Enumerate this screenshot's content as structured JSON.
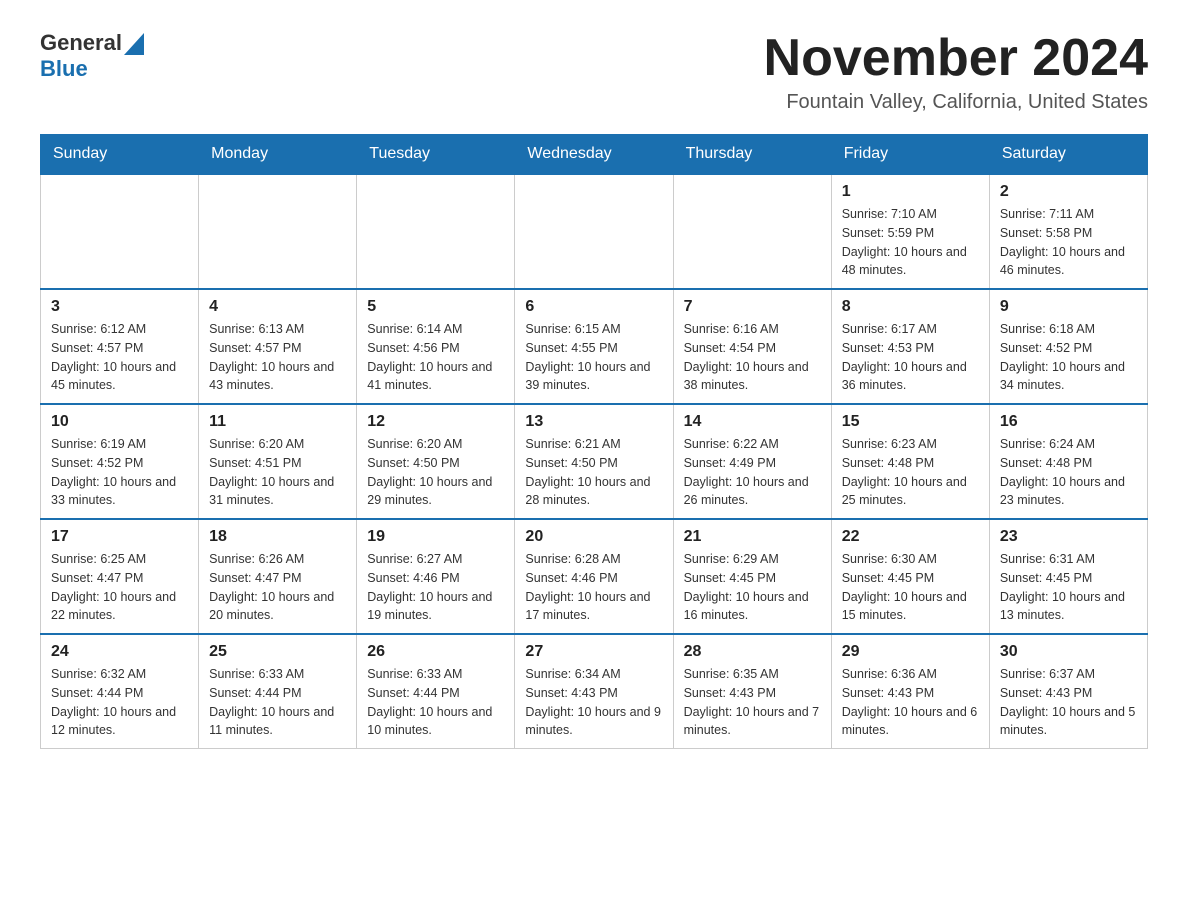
{
  "header": {
    "logo_general": "General",
    "logo_blue": "Blue",
    "month_title": "November 2024",
    "location": "Fountain Valley, California, United States"
  },
  "days_of_week": [
    "Sunday",
    "Monday",
    "Tuesday",
    "Wednesday",
    "Thursday",
    "Friday",
    "Saturday"
  ],
  "weeks": [
    [
      {
        "day": "",
        "info": ""
      },
      {
        "day": "",
        "info": ""
      },
      {
        "day": "",
        "info": ""
      },
      {
        "day": "",
        "info": ""
      },
      {
        "day": "",
        "info": ""
      },
      {
        "day": "1",
        "info": "Sunrise: 7:10 AM\nSunset: 5:59 PM\nDaylight: 10 hours and 48 minutes."
      },
      {
        "day": "2",
        "info": "Sunrise: 7:11 AM\nSunset: 5:58 PM\nDaylight: 10 hours and 46 minutes."
      }
    ],
    [
      {
        "day": "3",
        "info": "Sunrise: 6:12 AM\nSunset: 4:57 PM\nDaylight: 10 hours and 45 minutes."
      },
      {
        "day": "4",
        "info": "Sunrise: 6:13 AM\nSunset: 4:57 PM\nDaylight: 10 hours and 43 minutes."
      },
      {
        "day": "5",
        "info": "Sunrise: 6:14 AM\nSunset: 4:56 PM\nDaylight: 10 hours and 41 minutes."
      },
      {
        "day": "6",
        "info": "Sunrise: 6:15 AM\nSunset: 4:55 PM\nDaylight: 10 hours and 39 minutes."
      },
      {
        "day": "7",
        "info": "Sunrise: 6:16 AM\nSunset: 4:54 PM\nDaylight: 10 hours and 38 minutes."
      },
      {
        "day": "8",
        "info": "Sunrise: 6:17 AM\nSunset: 4:53 PM\nDaylight: 10 hours and 36 minutes."
      },
      {
        "day": "9",
        "info": "Sunrise: 6:18 AM\nSunset: 4:52 PM\nDaylight: 10 hours and 34 minutes."
      }
    ],
    [
      {
        "day": "10",
        "info": "Sunrise: 6:19 AM\nSunset: 4:52 PM\nDaylight: 10 hours and 33 minutes."
      },
      {
        "day": "11",
        "info": "Sunrise: 6:20 AM\nSunset: 4:51 PM\nDaylight: 10 hours and 31 minutes."
      },
      {
        "day": "12",
        "info": "Sunrise: 6:20 AM\nSunset: 4:50 PM\nDaylight: 10 hours and 29 minutes."
      },
      {
        "day": "13",
        "info": "Sunrise: 6:21 AM\nSunset: 4:50 PM\nDaylight: 10 hours and 28 minutes."
      },
      {
        "day": "14",
        "info": "Sunrise: 6:22 AM\nSunset: 4:49 PM\nDaylight: 10 hours and 26 minutes."
      },
      {
        "day": "15",
        "info": "Sunrise: 6:23 AM\nSunset: 4:48 PM\nDaylight: 10 hours and 25 minutes."
      },
      {
        "day": "16",
        "info": "Sunrise: 6:24 AM\nSunset: 4:48 PM\nDaylight: 10 hours and 23 minutes."
      }
    ],
    [
      {
        "day": "17",
        "info": "Sunrise: 6:25 AM\nSunset: 4:47 PM\nDaylight: 10 hours and 22 minutes."
      },
      {
        "day": "18",
        "info": "Sunrise: 6:26 AM\nSunset: 4:47 PM\nDaylight: 10 hours and 20 minutes."
      },
      {
        "day": "19",
        "info": "Sunrise: 6:27 AM\nSunset: 4:46 PM\nDaylight: 10 hours and 19 minutes."
      },
      {
        "day": "20",
        "info": "Sunrise: 6:28 AM\nSunset: 4:46 PM\nDaylight: 10 hours and 17 minutes."
      },
      {
        "day": "21",
        "info": "Sunrise: 6:29 AM\nSunset: 4:45 PM\nDaylight: 10 hours and 16 minutes."
      },
      {
        "day": "22",
        "info": "Sunrise: 6:30 AM\nSunset: 4:45 PM\nDaylight: 10 hours and 15 minutes."
      },
      {
        "day": "23",
        "info": "Sunrise: 6:31 AM\nSunset: 4:45 PM\nDaylight: 10 hours and 13 minutes."
      }
    ],
    [
      {
        "day": "24",
        "info": "Sunrise: 6:32 AM\nSunset: 4:44 PM\nDaylight: 10 hours and 12 minutes."
      },
      {
        "day": "25",
        "info": "Sunrise: 6:33 AM\nSunset: 4:44 PM\nDaylight: 10 hours and 11 minutes."
      },
      {
        "day": "26",
        "info": "Sunrise: 6:33 AM\nSunset: 4:44 PM\nDaylight: 10 hours and 10 minutes."
      },
      {
        "day": "27",
        "info": "Sunrise: 6:34 AM\nSunset: 4:43 PM\nDaylight: 10 hours and 9 minutes."
      },
      {
        "day": "28",
        "info": "Sunrise: 6:35 AM\nSunset: 4:43 PM\nDaylight: 10 hours and 7 minutes."
      },
      {
        "day": "29",
        "info": "Sunrise: 6:36 AM\nSunset: 4:43 PM\nDaylight: 10 hours and 6 minutes."
      },
      {
        "day": "30",
        "info": "Sunrise: 6:37 AM\nSunset: 4:43 PM\nDaylight: 10 hours and 5 minutes."
      }
    ]
  ]
}
